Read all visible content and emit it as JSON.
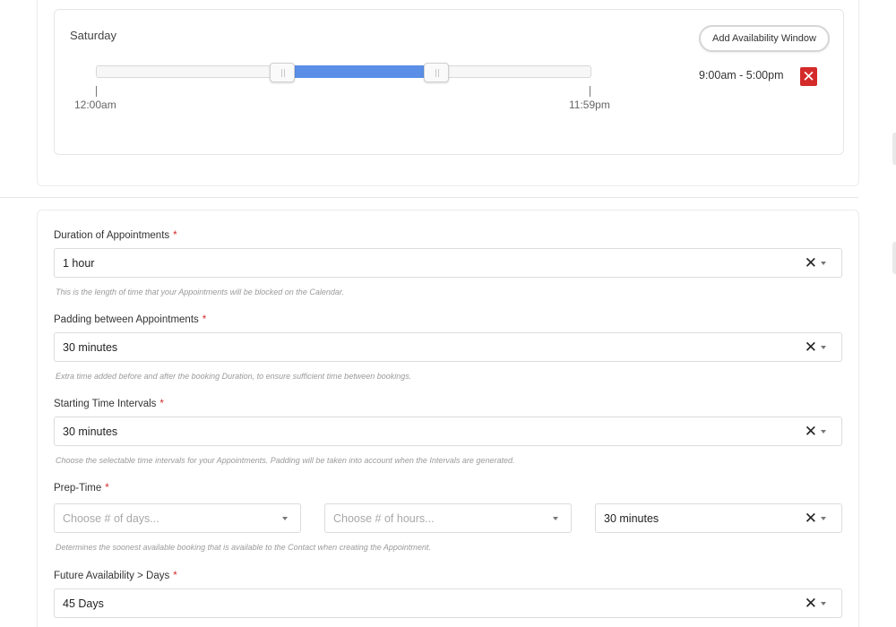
{
  "availability": {
    "day": "Saturday",
    "add_window_label": "Add Availability Window",
    "slider": {
      "start_fraction": 0.375,
      "end_fraction": 0.6875
    },
    "start_tick_label": "12:00am",
    "end_tick_label": "11:59pm",
    "range_text": "9:00am - 5:00pm",
    "remove_icon": "close-icon",
    "accent_color": "#5b8ee6",
    "remove_color": "#d42a2a"
  },
  "fields": {
    "duration": {
      "label": "Duration of Appointments",
      "required_mark": "*",
      "value": "1 hour",
      "help": "This is the length of time that your Appointments will be blocked on the Calendar."
    },
    "padding": {
      "label": "Padding between Appointments",
      "required_mark": "*",
      "value": "30 minutes",
      "help": "Extra time added before and after the booking Duration, to ensure sufficient time between bookings."
    },
    "intervals": {
      "label": "Starting Time Intervals",
      "required_mark": "*",
      "value": "30 minutes",
      "help": "Choose the selectable time intervals for your Appointments. Padding will be taken into account when the Intervals are generated."
    },
    "prep_time": {
      "label": "Prep-Time",
      "required_mark": "*",
      "days_placeholder": "Choose # of days...",
      "hours_placeholder": "Choose # of hours...",
      "minutes_value": "30 minutes",
      "help": "Determines the soonest available booking that is available to the Contact when creating the Appointment."
    },
    "future": {
      "label": "Future Availability > Days",
      "required_mark": "*",
      "value": "45 Days"
    }
  },
  "icons": {
    "clear": "close-icon",
    "caret": "caret-down-icon"
  }
}
